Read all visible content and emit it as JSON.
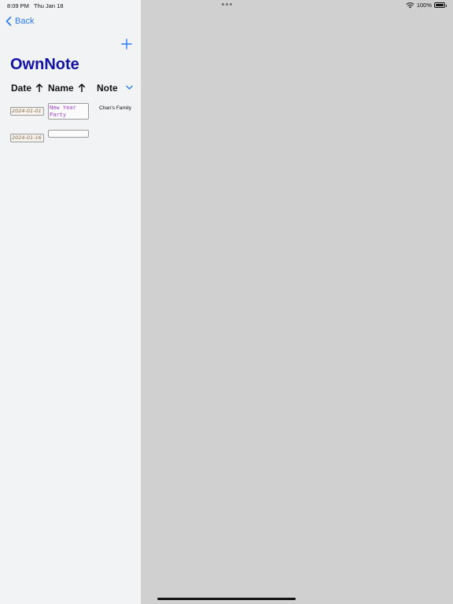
{
  "status_bar": {
    "time": "8:09 PM",
    "date": "Thu Jan 18",
    "battery": "100%"
  },
  "nav": {
    "back_label": "Back",
    "add_icon": "plus-icon"
  },
  "title": "OwnNote",
  "columns": {
    "date": "Date",
    "name": "Name",
    "note": "Note",
    "date_sort_icon": "arrow-up-icon",
    "name_sort_icon": "arrow-up-icon",
    "filter_icon": "chevron-down-icon"
  },
  "rows": [
    {
      "date": "2024-01-01",
      "name": "New Year Party",
      "note": "Chan's Family"
    },
    {
      "date": "2024-01-16",
      "name": "",
      "note": ""
    }
  ],
  "colors": {
    "accent": "#2a7bf5",
    "title": "#1212a4",
    "name_text": "#a23fd4",
    "sidebar_bg": "#f2f3f5",
    "detail_bg": "#d0d0d0"
  }
}
